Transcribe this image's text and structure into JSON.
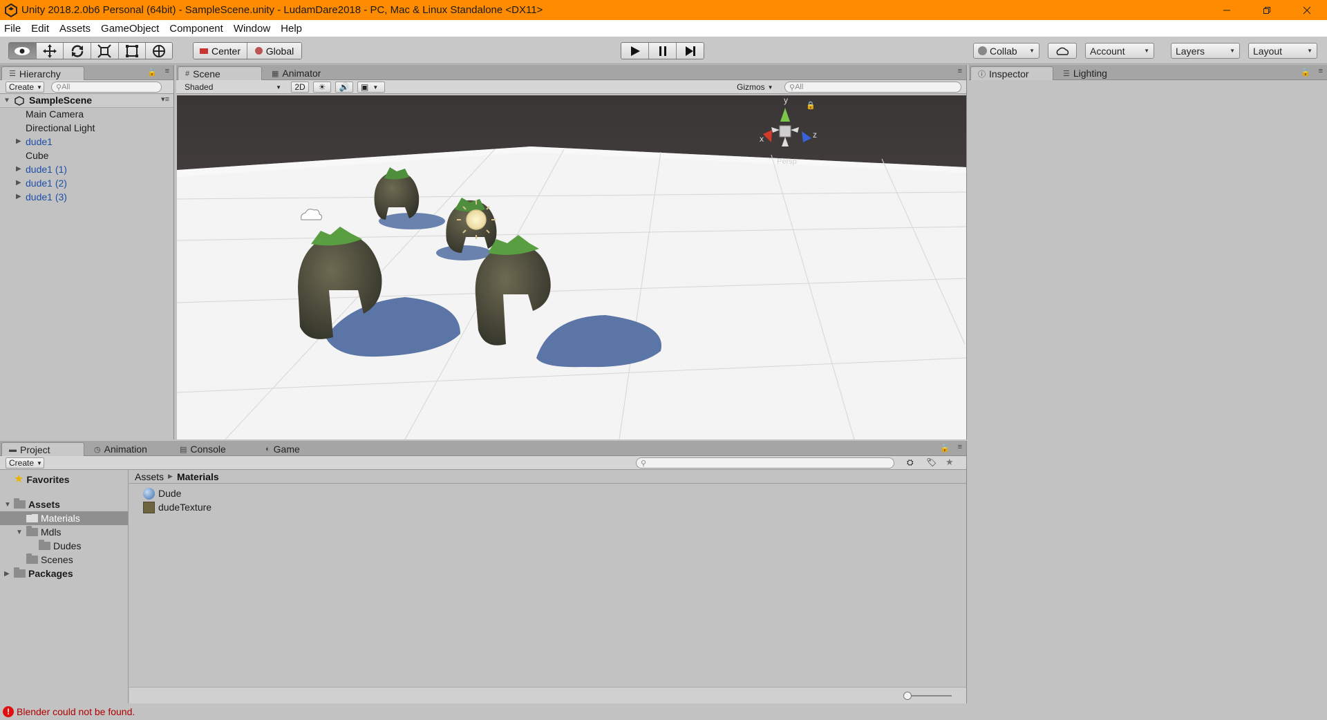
{
  "window": {
    "title": "Unity 2018.2.0b6 Personal (64bit) - SampleScene.unity - LudamDare2018 - PC, Mac & Linux Standalone <DX11>",
    "accent": "#ff8c00"
  },
  "menu": [
    "File",
    "Edit",
    "Assets",
    "GameObject",
    "Component",
    "Window",
    "Help"
  ],
  "toolbar": {
    "tools": [
      "view-tool",
      "move-tool",
      "rotate-tool",
      "scale-tool",
      "rect-tool",
      "transform-tool"
    ],
    "pivot": "Center",
    "space": "Global",
    "collab": "Collab",
    "account": "Account",
    "layers": "Layers",
    "layout": "Layout"
  },
  "hierarchy": {
    "tab": "Hierarchy",
    "create": "Create",
    "search_placeholder": "All",
    "scene": "SampleScene",
    "items": [
      {
        "label": "Main Camera",
        "prefab": false,
        "expandable": false
      },
      {
        "label": "Directional Light",
        "prefab": false,
        "expandable": false
      },
      {
        "label": "dude1",
        "prefab": true,
        "expandable": true
      },
      {
        "label": "Cube",
        "prefab": false,
        "expandable": false
      },
      {
        "label": "dude1 (1)",
        "prefab": true,
        "expandable": true
      },
      {
        "label": "dude1 (2)",
        "prefab": true,
        "expandable": true
      },
      {
        "label": "dude1 (3)",
        "prefab": true,
        "expandable": true
      }
    ]
  },
  "scene_view": {
    "tabs": [
      "Scene",
      "Animator"
    ],
    "shading": "Shaded",
    "mode_2d": "2D",
    "gizmos": "Gizmos",
    "search_placeholder": "All",
    "gizmo_axes": {
      "y": "y",
      "x": "x",
      "z": "z"
    },
    "projection": "Persp"
  },
  "inspector": {
    "tabs": [
      "Inspector",
      "Lighting"
    ]
  },
  "bottom_tabs": [
    "Project",
    "Animation",
    "Console",
    "Game"
  ],
  "project": {
    "create": "Create",
    "favorites": "Favorites",
    "tree": [
      {
        "label": "Assets",
        "bold": true
      },
      {
        "label": "Materials",
        "selected": true
      },
      {
        "label": "Mdls"
      },
      {
        "label": "Dudes"
      },
      {
        "label": "Scenes"
      },
      {
        "label": "Packages",
        "bold": true
      }
    ],
    "breadcrumb": [
      "Assets",
      "Materials"
    ],
    "assets": [
      "Dude",
      "dudeTexture"
    ]
  },
  "status": {
    "message": "Blender could not be found."
  }
}
